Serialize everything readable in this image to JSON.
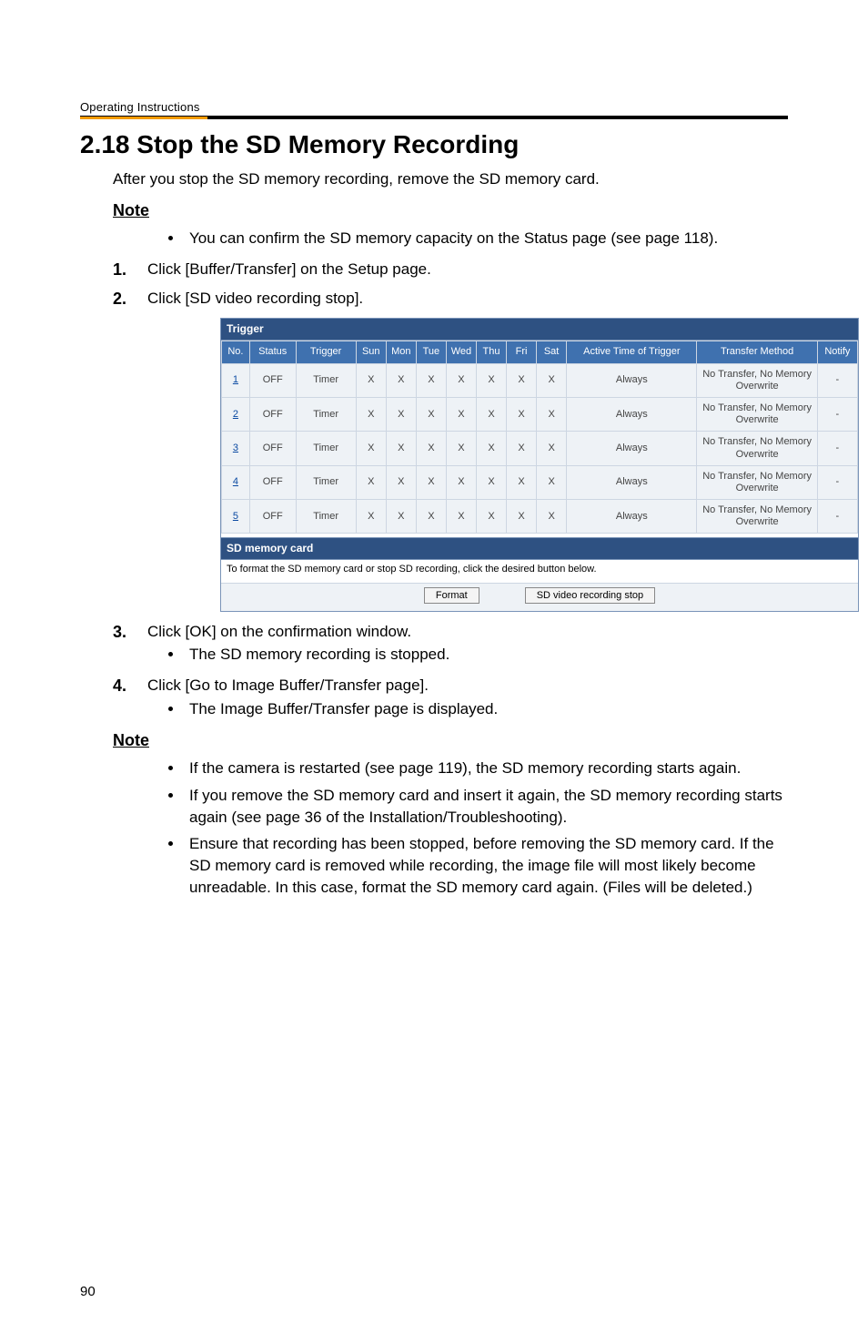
{
  "running_head": "Operating Instructions",
  "section_title": "2.18  Stop the SD Memory Recording",
  "intro": "After you stop the SD memory recording, remove the SD memory card.",
  "note_label": "Note",
  "note1_items": [
    "You can confirm the SD memory capacity on the Status page (see page 118)."
  ],
  "steps": {
    "s1": "Click [Buffer/Transfer] on the Setup page.",
    "s2": "Click [SD video recording stop].",
    "s3": {
      "text": "Click [OK] on the confirmation window.",
      "sub": [
        "The SD memory recording is stopped."
      ]
    },
    "s4": {
      "text": "Click [Go to Image Buffer/Transfer page].",
      "sub": [
        "The Image Buffer/Transfer page is displayed."
      ]
    }
  },
  "screenshot": {
    "panel_title": "Trigger",
    "headers": [
      "No.",
      "Status",
      "Trigger",
      "Sun",
      "Mon",
      "Tue",
      "Wed",
      "Thu",
      "Fri",
      "Sat",
      "Active Time of Trigger",
      "Transfer Method",
      "Notify"
    ],
    "rows": [
      {
        "no": "1",
        "status": "OFF",
        "trigger": "Timer",
        "days": [
          "X",
          "X",
          "X",
          "X",
          "X",
          "X",
          "X"
        ],
        "active": "Always",
        "method": "No Transfer, No Memory Overwrite",
        "notify": "-"
      },
      {
        "no": "2",
        "status": "OFF",
        "trigger": "Timer",
        "days": [
          "X",
          "X",
          "X",
          "X",
          "X",
          "X",
          "X"
        ],
        "active": "Always",
        "method": "No Transfer, No Memory Overwrite",
        "notify": "-"
      },
      {
        "no": "3",
        "status": "OFF",
        "trigger": "Timer",
        "days": [
          "X",
          "X",
          "X",
          "X",
          "X",
          "X",
          "X"
        ],
        "active": "Always",
        "method": "No Transfer, No Memory Overwrite",
        "notify": "-"
      },
      {
        "no": "4",
        "status": "OFF",
        "trigger": "Timer",
        "days": [
          "X",
          "X",
          "X",
          "X",
          "X",
          "X",
          "X"
        ],
        "active": "Always",
        "method": "No Transfer, No Memory Overwrite",
        "notify": "-"
      },
      {
        "no": "5",
        "status": "OFF",
        "trigger": "Timer",
        "days": [
          "X",
          "X",
          "X",
          "X",
          "X",
          "X",
          "X"
        ],
        "active": "Always",
        "method": "No Transfer, No Memory Overwrite",
        "notify": "-"
      }
    ],
    "lower_title": "SD memory card",
    "lower_caption": "To format the SD memory card or stop SD recording, click the desired button below.",
    "btn_format": "Format",
    "btn_stop": "SD video recording stop"
  },
  "note2_items": [
    "If the camera is restarted (see page 119), the SD memory recording starts again.",
    "If you remove the SD memory card and insert it again, the SD memory recording starts again (see page 36 of the Installation/Troubleshooting).",
    "Ensure that recording has been stopped, before removing the SD memory card. If the SD memory card is removed while recording, the image file will most likely become unreadable. In this case, format the SD memory card again. (Files will be deleted.)"
  ],
  "page_number": "90"
}
